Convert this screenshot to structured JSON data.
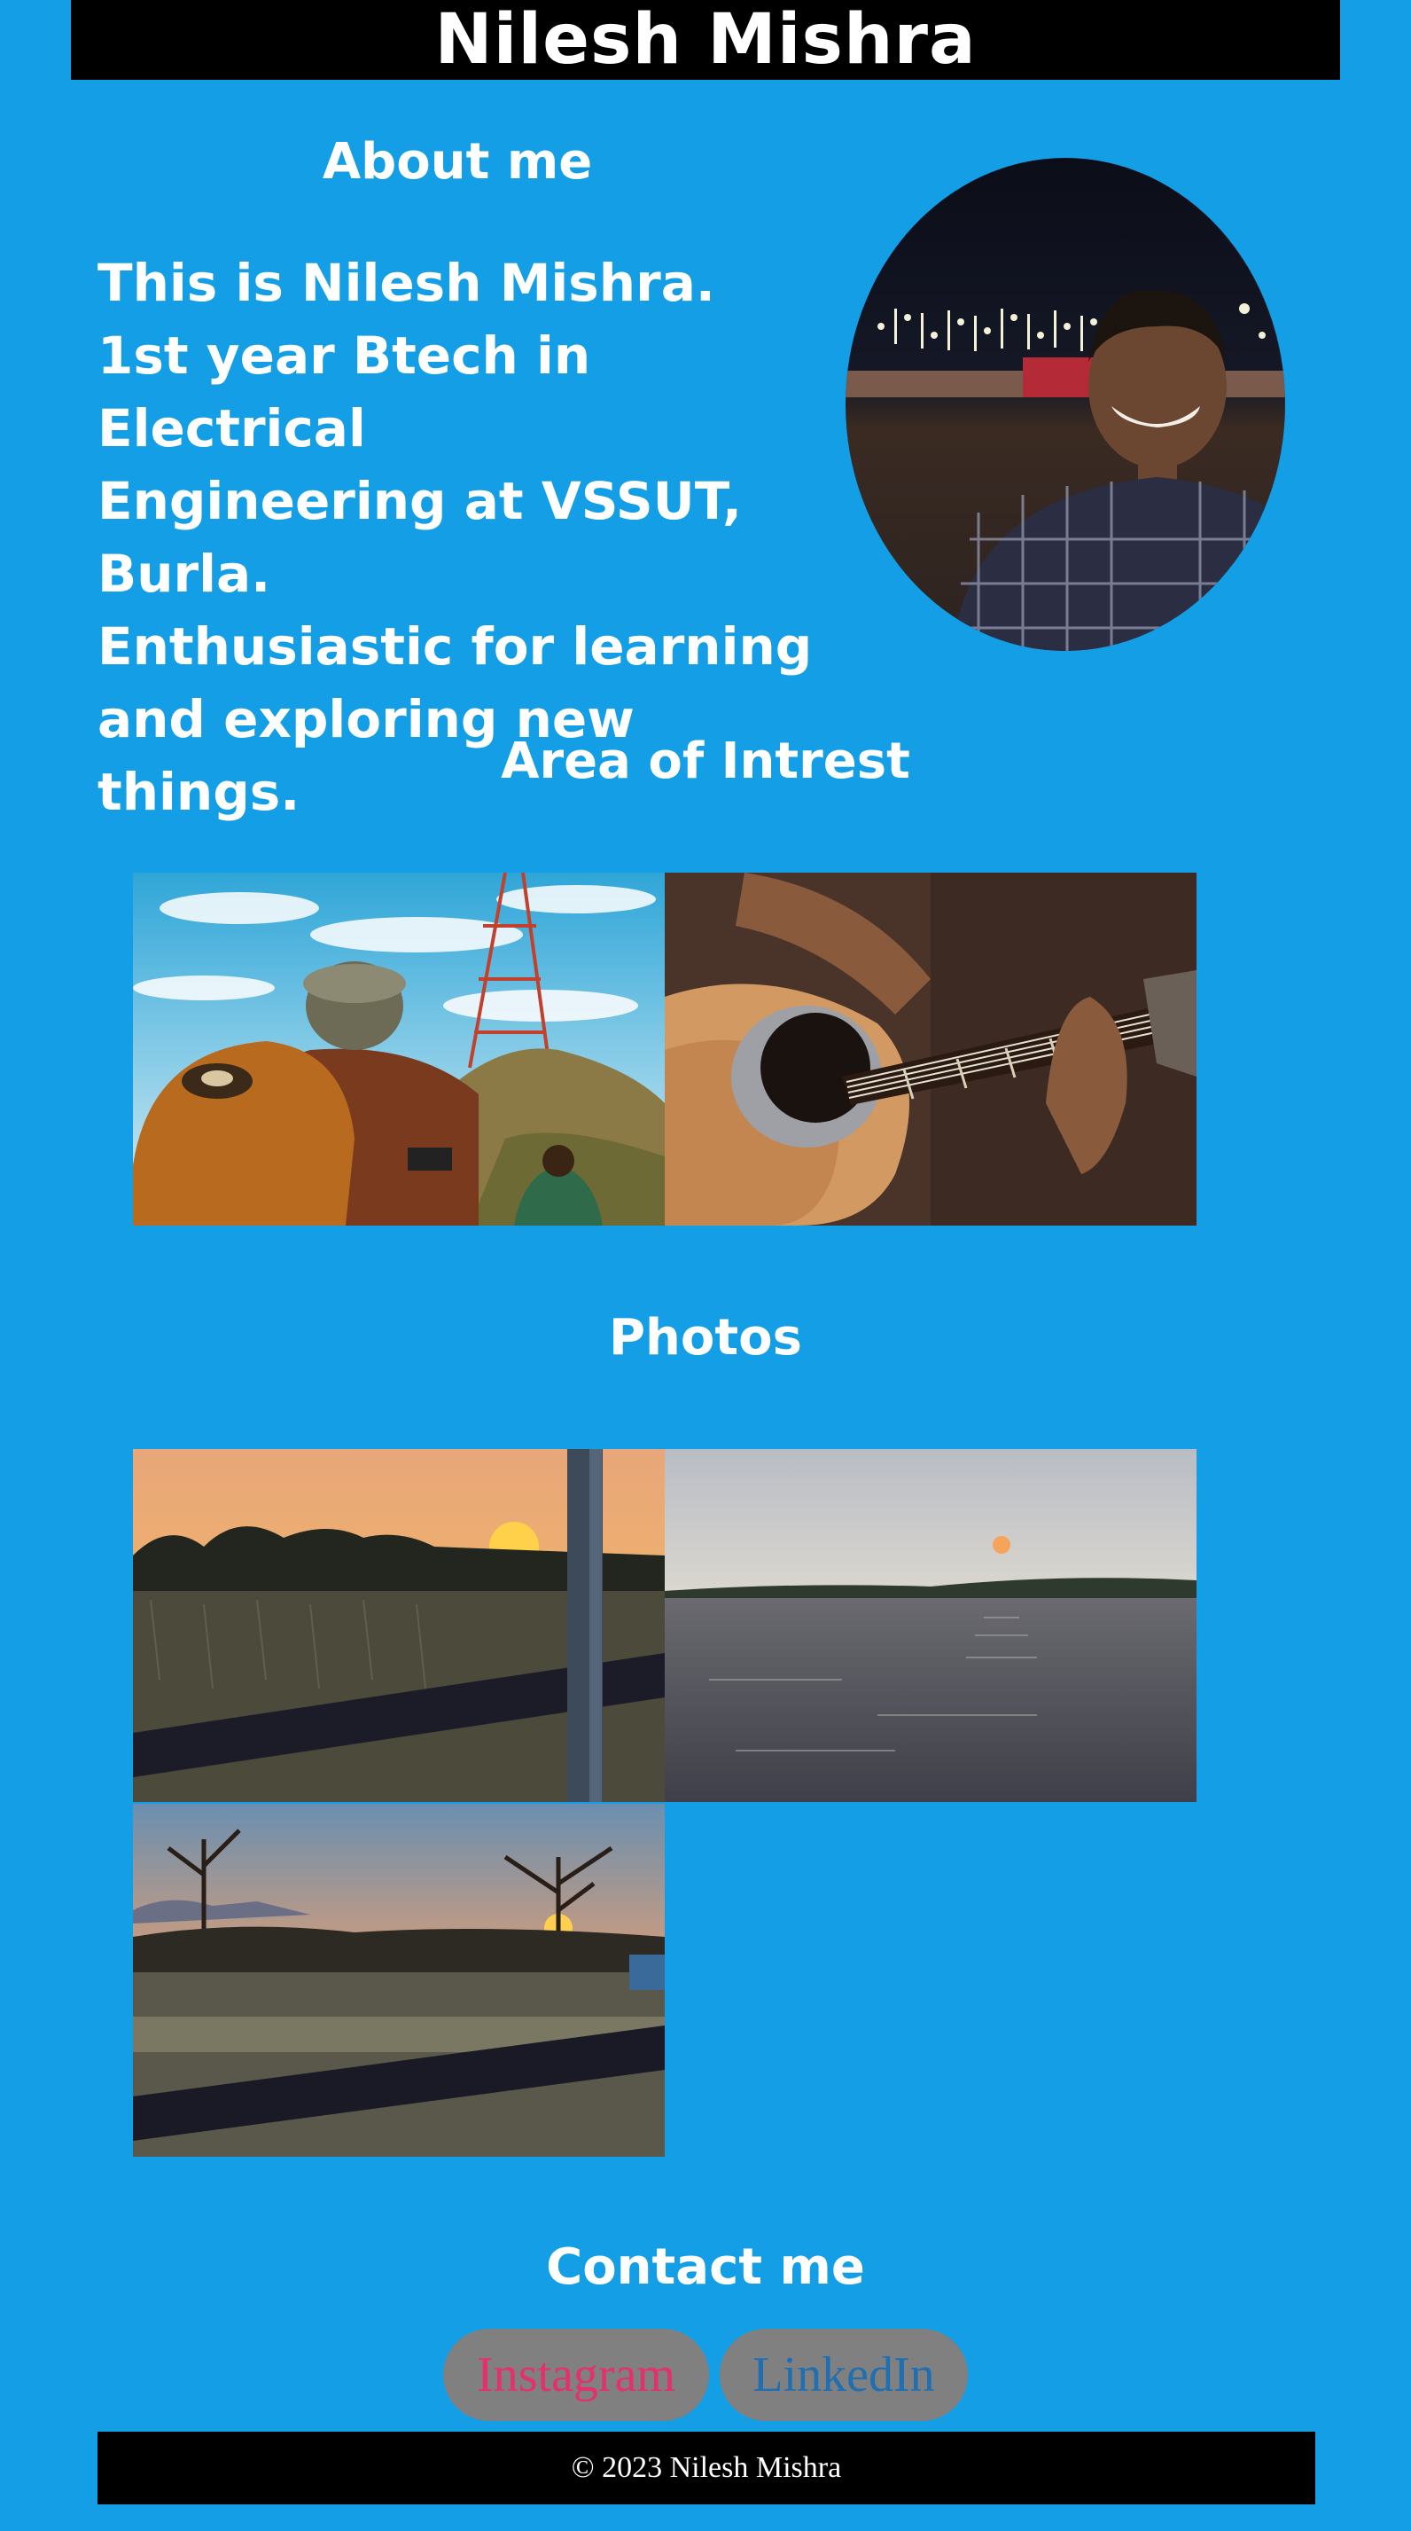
{
  "header": {
    "title": "Nilesh Mishra"
  },
  "about": {
    "title": "About me",
    "text": "This is Nilesh Mishra.\n1st year Btech in Electrical\nEngineering at VSSUT,\nBurla.\nEnthusiastic for learning\nand exploring new things."
  },
  "interests": {
    "title": "Area of Intrest"
  },
  "photos": {
    "title": "Photos"
  },
  "contact": {
    "title": "Contact me",
    "instagram_label": "Instagram",
    "linkedin_label": "LinkedIn"
  },
  "footer": {
    "text": "© 2023 Nilesh Mishra"
  },
  "colors": {
    "background": "#139ee6",
    "header_bg": "#000000",
    "button_bg": "#808080",
    "instagram_text": "#e4306c",
    "linkedin_text": "#1f6fb2"
  }
}
